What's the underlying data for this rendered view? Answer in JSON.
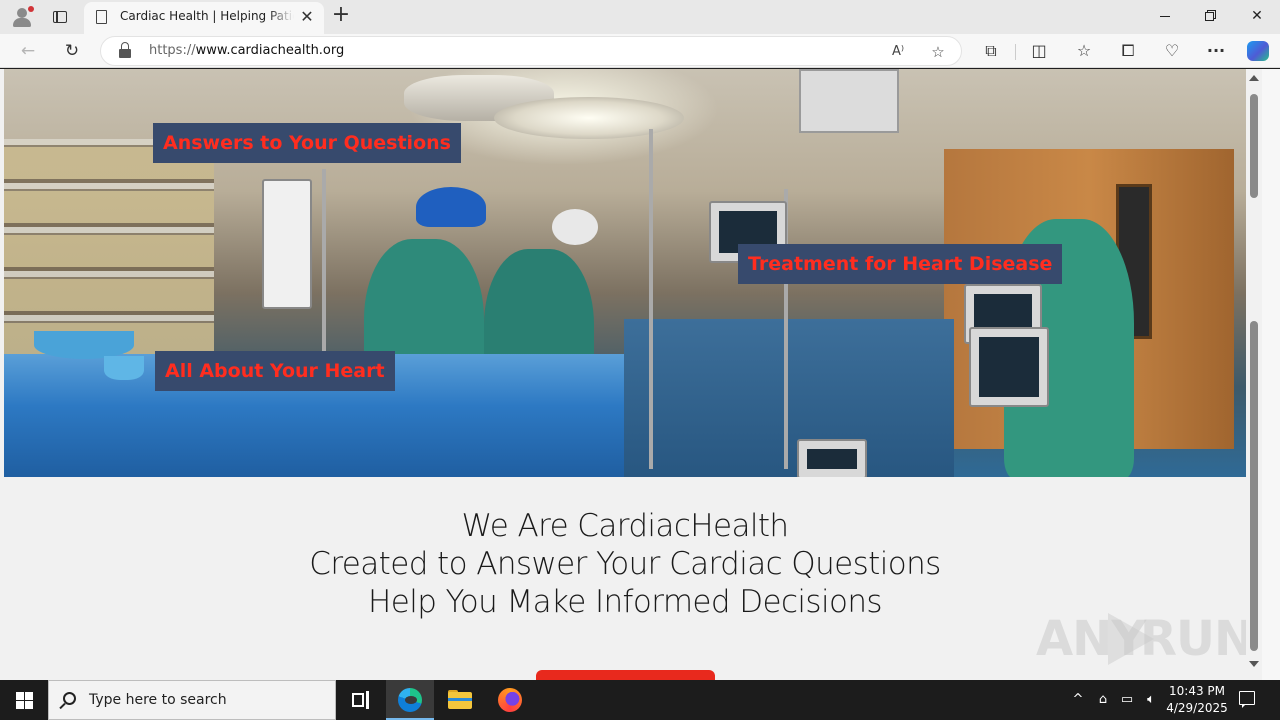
{
  "browser": {
    "tab": {
      "title": "Cardiac Health | Helping Patients Make Informed Decisions",
      "close_glyph": "✕"
    },
    "new_tab_glyph": "+",
    "window_controls": {
      "close_glyph": "✕"
    },
    "toolbar": {
      "back_glyph": "←",
      "reload_glyph": "↻",
      "url_protocol": "https://",
      "url_host": "www.cardiachealth.org",
      "read_aloud_glyph": "A⁾",
      "favorite_glyph": "☆",
      "extensions_glyph": "⧉",
      "split_glyph": "◫",
      "favorites_glyph": "☆",
      "collections_glyph": "⧠",
      "performance_glyph": "♡",
      "more_glyph": "···"
    }
  },
  "page": {
    "hero_links": [
      {
        "label": "Answers to Your Questions"
      },
      {
        "label": "Treatment for Heart Disease"
      },
      {
        "label": "All About Your Heart"
      }
    ],
    "intro_lines": [
      "We Are CardiacHealth",
      "Created to Answer Your Cardiac Questions",
      "Help You Make Informed Decisions"
    ],
    "watermark": {
      "left": "ANY",
      "right": "RUN"
    },
    "accent_color": "#ff2d1f",
    "hero_label_bg": "#374a6d"
  },
  "taskbar": {
    "search_placeholder": "Type here to search",
    "tray_chevron": "^",
    "time": "10:43 PM",
    "date": "4/29/2025"
  },
  "icons": [
    "profile-icon",
    "tab-actions-icon",
    "document-icon",
    "lock-icon",
    "copilot-icon",
    "windows-start-icon",
    "search-icon",
    "edge-icon",
    "file-explorer-icon",
    "firefox-icon",
    "network-icon",
    "volume-icon",
    "notification-icon"
  ]
}
